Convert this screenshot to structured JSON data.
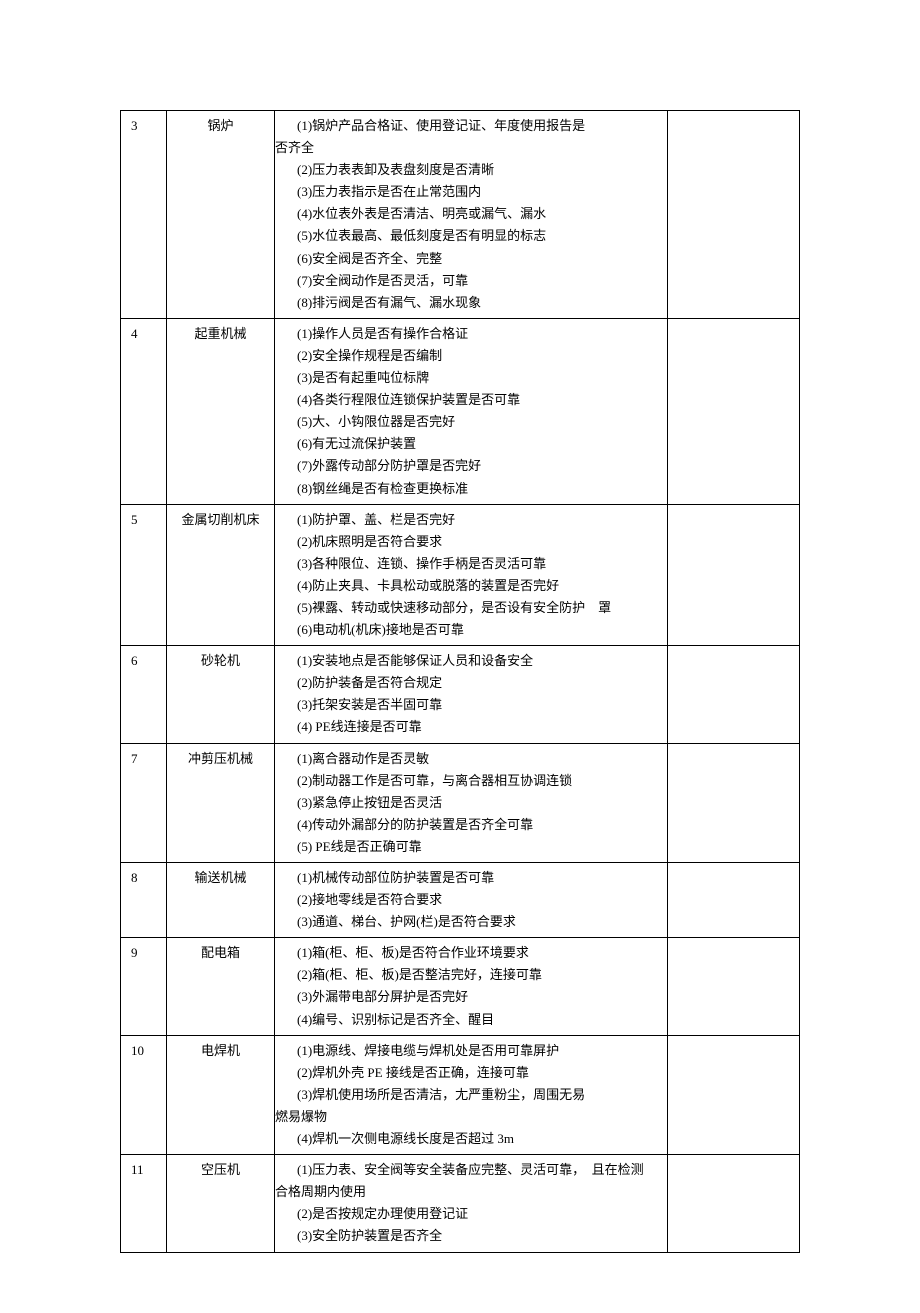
{
  "rows": [
    {
      "num": "3",
      "name": "锅炉",
      "items": [
        "(1)锅炉产品合格证、使用登记证、年度使用报告是",
        "__UN__否齐全",
        "(2)压力表表卸及表盘刻度是否清晰",
        "(3)压力表指示是否在止常范围内",
        "(4)水位表外表是否清洁、明亮或漏气、漏水",
        "(5)水位表最高、最低刻度是否有明显的标志",
        "(6)安全阀是否齐全、完整",
        "(7)安全阀动作是否灵活，可靠",
        "(8)排污阀是否有漏气、漏水现象"
      ]
    },
    {
      "num": "4",
      "name": "起重机械",
      "items": [
        "(1)操作人员是否有操作合格证",
        "(2)安全操作规程是否编制",
        "(3)是否有起重吨位标牌",
        "(4)各类行程限位连锁保护装置是否可靠",
        "(5)大、小钩限位器是否完好",
        "(6)有无过流保护装置",
        "(7)外露传动部分防护罩是否完好",
        "(8)钢丝绳是否有检查更换标准"
      ]
    },
    {
      "num": "5",
      "name": "金属切削机床",
      "items": [
        "",
        "(1)防护罩、盖、栏是否完好",
        "(2)机床照明是否符合要求",
        "(3)各种限位、连锁、操作手柄是否灵活可靠",
        "(4)防止夹具、卡具松动或脱落的装置是否完好",
        "(5)裸露、转动或快速移动部分，是否设有安全防护　罩",
        "(6)电动机(机床)接地是否可靠"
      ]
    },
    {
      "num": "6",
      "name": "砂轮机",
      "items": [
        "(1)安装地点是否能够保证人员和设备安全",
        "(2)防护装备是否符合规定",
        "(3)托架安装是否半固可靠",
        "(4) PE线连接是否可靠"
      ]
    },
    {
      "num": "7",
      "name": "冲剪压机械",
      "items": [
        "(1)离合器动作是否灵敏",
        "(2)制动器工作是否可靠，与离合器相互协调连锁",
        "(3)紧急停止按钮是否灵活",
        "(4)传动外漏部分的防护装置是否齐全可靠",
        "(5) PE线是否正确可靠"
      ]
    },
    {
      "num": "8",
      "name": "输送机械",
      "items": [
        "(1)机械传动部位防护装置是否可靠",
        "(2)接地零线是否符合要求",
        "(3)通道、梯台、护网(栏)是否符合要求"
      ]
    },
    {
      "num": "9",
      "name": "配电箱",
      "items": [
        "(1)箱(柜、柜、板)是否符合作业环境要求",
        "(2)箱(柜、柜、板)是否整洁完好，连接可靠",
        "(3)外漏带电部分屏护是否完好",
        "(4)编号、识别标记是否齐全、醒目"
      ]
    },
    {
      "num": "10",
      "name": "电焊机",
      "items": [
        "(1)电源线、焊接电缆与焊机处是否用可靠屏护",
        "(2)焊机外壳 PE 接线是否正确，连接可靠",
        "(3)焊机使用场所是否清洁，尢严重粉尘，周围无易",
        "__UN__燃易爆物",
        "(4)焊机一次侧电源线长度是否超过 3m"
      ]
    },
    {
      "num": "11",
      "name": "空压机",
      "items": [
        "(1)压力表、安全阀等安全装备应完整、灵活可靠，　且在检测",
        "__UN__合格周期内使用",
        "(2)是否按规定办理使用登记证",
        "(3)安全防护装置是否齐全"
      ]
    }
  ]
}
